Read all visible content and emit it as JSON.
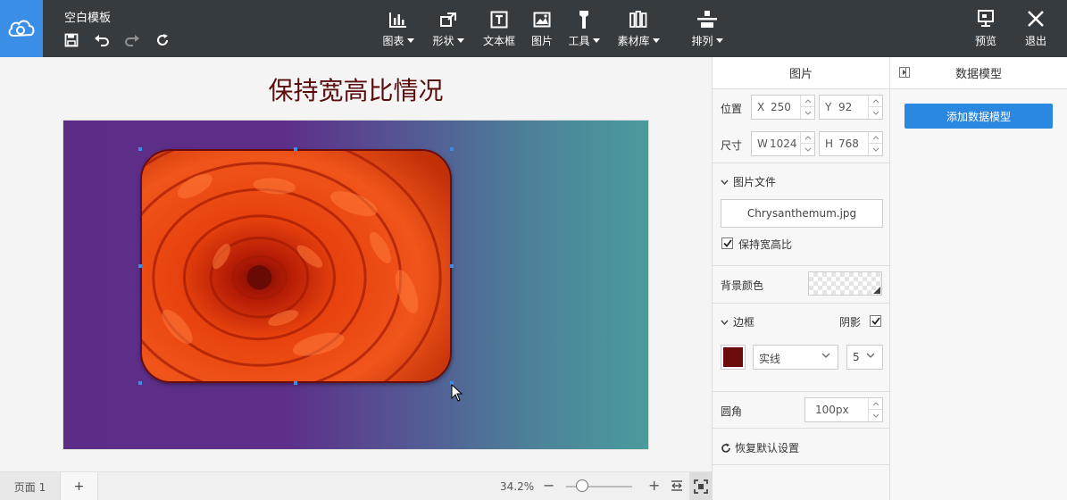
{
  "app": {
    "doc_title": "空白模板"
  },
  "toolbar": {
    "items": [
      {
        "label": "图表",
        "icon": "bar-chart-icon"
      },
      {
        "label": "形状",
        "icon": "shape-icon"
      },
      {
        "label": "文本框",
        "icon": "textbox-icon"
      },
      {
        "label": "图片",
        "icon": "image-icon"
      },
      {
        "label": "工具",
        "icon": "tool-icon"
      },
      {
        "label": "素材库",
        "icon": "library-icon"
      },
      {
        "label": "排列",
        "icon": "arrange-icon"
      }
    ],
    "preview_label": "预览",
    "exit_label": "退出"
  },
  "canvas": {
    "heading": "保持宽高比情况",
    "image_colors": {
      "bg_left": "#5b2d86",
      "bg_right": "#4a9c9c",
      "border": "#6b0b0b"
    }
  },
  "bottom": {
    "page_tab": "页面 1",
    "add_page": "+",
    "zoom": "34.2%",
    "zoom_level": 0.2
  },
  "props": {
    "title": "图片",
    "position_label": "位置",
    "x_prefix": "X",
    "x_value": "250",
    "y_prefix": "Y",
    "y_value": "92",
    "size_label": "尺寸",
    "w_prefix": "W",
    "w_value": "1024",
    "h_prefix": "H",
    "h_value": "768",
    "image_file_label": "图片文件",
    "file_name": "Chrysanthemum.jpg",
    "keep_ratio_label": "保持宽高比",
    "keep_ratio_checked": true,
    "bg_color_label": "背景颜色",
    "border_label": "边框",
    "shadow_label": "阴影",
    "shadow_checked": true,
    "border_color": "#6b0b0b",
    "border_style": "实线",
    "border_width": "5",
    "radius_label": "圆角",
    "radius_value": "100px",
    "reset_label": "恢复默认设置"
  },
  "data_model": {
    "title": "数据模型",
    "add_button": "添加数据模型",
    "button_color": "#2b88e0"
  }
}
